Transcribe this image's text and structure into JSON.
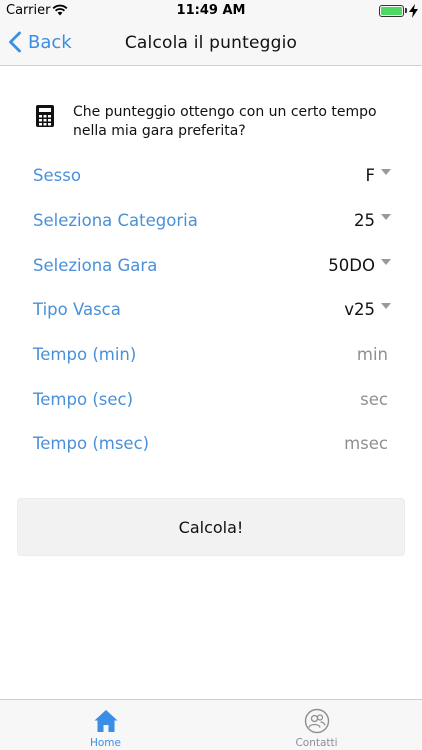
{
  "status_bar": {
    "carrier": "Carrier",
    "time": "11:49 AM",
    "battery_color": "#4cd964"
  },
  "nav": {
    "back_label": "Back",
    "title": "Calcola il punteggio"
  },
  "intro": {
    "icon": "calculator-icon",
    "text": "Che punteggio ottengo con un certo tempo nella mia gara preferita?"
  },
  "form": {
    "sesso": {
      "label": "Sesso",
      "value": "F"
    },
    "categoria": {
      "label": "Seleziona Categoria",
      "value": "25"
    },
    "gara": {
      "label": "Seleziona Gara",
      "value": "50DO"
    },
    "vasca": {
      "label": "Tipo Vasca",
      "value": "v25"
    },
    "tempo_min": {
      "label": "Tempo (min)",
      "placeholder": "min"
    },
    "tempo_sec": {
      "label": "Tempo (sec)",
      "placeholder": "sec"
    },
    "tempo_msec": {
      "label": "Tempo (msec)",
      "placeholder": "msec"
    }
  },
  "button": {
    "label": "Calcola!"
  },
  "tabs": [
    {
      "label": "Home",
      "icon": "home-icon",
      "active": true
    },
    {
      "label": "Contatti",
      "icon": "contacts-icon",
      "active": false
    }
  ],
  "colors": {
    "accent": "#3a8ee6",
    "label_blue": "#4a90d9",
    "placeholder_gray": "#8f8f8f"
  }
}
